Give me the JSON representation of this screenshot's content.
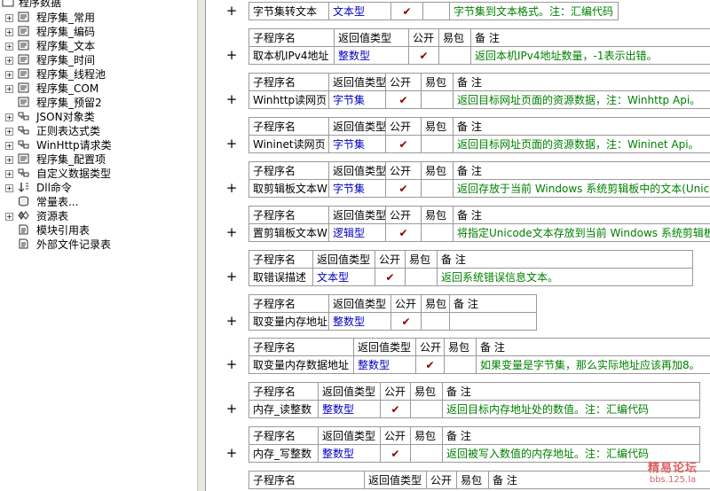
{
  "tree": {
    "root": "程序数据",
    "items": [
      {
        "label": "程序集_常用",
        "icon": "module-icon",
        "expander": "+"
      },
      {
        "label": "程序集_编码",
        "icon": "module-icon",
        "expander": "+"
      },
      {
        "label": "程序集_文本",
        "icon": "module-icon",
        "expander": "+"
      },
      {
        "label": "程序集_时间",
        "icon": "module-icon",
        "expander": "+"
      },
      {
        "label": "程序集_线程池",
        "icon": "module-icon",
        "expander": "+"
      },
      {
        "label": "程序集_COM",
        "icon": "module-icon",
        "expander": "+"
      },
      {
        "label": "程序集_预留2",
        "icon": "module-icon",
        "expander": ""
      },
      {
        "label": "JSON对象类",
        "icon": "class-icon",
        "expander": "+"
      },
      {
        "label": "正则表达式类",
        "icon": "class-icon",
        "expander": "+"
      },
      {
        "label": "WinHttp请求类",
        "icon": "class-icon",
        "expander": "+"
      },
      {
        "label": "程序集_配置项",
        "icon": "module-icon",
        "expander": "+"
      },
      {
        "label": "自定义数据类型",
        "icon": "class-icon",
        "expander": "+"
      },
      {
        "label": "Dll命令",
        "icon": "dll-icon",
        "expander": "+"
      },
      {
        "label": "常量表...",
        "icon": "constant-icon",
        "expander": ""
      },
      {
        "label": "资源表",
        "icon": "resource-icon",
        "expander": "+"
      },
      {
        "label": "模块引用表",
        "icon": "doc-icon",
        "expander": ""
      },
      {
        "label": "外部文件记录表",
        "icon": "doc-icon",
        "expander": ""
      }
    ]
  },
  "headers": {
    "name": "子程序名",
    "ret": "返回值类型",
    "pub": "公开",
    "easy": "易包",
    "remark": "备 注"
  },
  "check_mark": "✔",
  "plus_sign": "+",
  "subs": [
    {
      "name": "字节集转文本",
      "ret": "文本型",
      "pub": true,
      "remark": "字节集到文本格式。注：汇编代码",
      "no_header": true
    },
    {
      "name": "取本机IPv4地址",
      "ret": "整数型",
      "pub": true,
      "remark": "返回本机IPv4地址数量，-1表示出错。"
    },
    {
      "name": "Winhttp读网页",
      "ret": "字节集",
      "pub": true,
      "remark": "返回目标网址页面的资源数据，注：Winhttp Api。"
    },
    {
      "name": "Wininet读网页",
      "ret": "字节集",
      "pub": true,
      "remark": "返回目标网址页面的资源数据，注：Wininet Api。"
    },
    {
      "name": "取剪辑板文本W",
      "ret": "字节集",
      "pub": true,
      "remark": "返回存放于当前 Windows 系统剪辑板中的文本(Unicode"
    },
    {
      "name": "置剪辑板文本W",
      "ret": "逻辑型",
      "pub": true,
      "remark": "将指定Unicode文本存放到当前 Windows 系统剪辑板中"
    },
    {
      "name": "取错误描述",
      "ret": "文本型",
      "pub": true,
      "remark": "返回系统错误信息文本。"
    },
    {
      "name": "取变量内存地址",
      "ret": "整数型",
      "pub": true,
      "remark": ""
    },
    {
      "name": "取变量内存数据地址",
      "ret": "整数型",
      "pub": true,
      "remark": "如果变量是字节集，那么实际地址应该再加8。"
    },
    {
      "name": "内存_读整数",
      "ret": "整数型",
      "pub": true,
      "remark": "返回目标内存地址处的数值。注：汇编代码"
    },
    {
      "name": "内存_写整数",
      "ret": "整数型",
      "pub": true,
      "remark": "返回被写入数值的内存地址。注：汇编代码"
    },
    {
      "name": "",
      "ret": "",
      "pub": false,
      "remark": "",
      "header_only": true
    }
  ],
  "watermark": {
    "line1": "精易论坛",
    "line2": "bbs.125.la"
  }
}
